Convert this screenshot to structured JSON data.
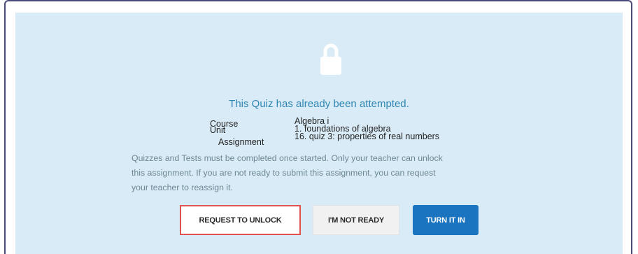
{
  "message": {
    "title": "This Quiz has already been attempted.",
    "labels": {
      "course": "Course",
      "unit": "Unit",
      "assignment": "Assignment"
    },
    "values": {
      "course": "Algebra i",
      "unit": "1. foundations of algebra",
      "assignment": "16. quiz 3: properties of real numbers"
    },
    "description_lines": [
      "Quizzes and Tests must be completed once started. Only your teacher can unlock",
      "this assignment. If you are not ready to submit this assignment, you can request",
      "your teacher to reassign it."
    ]
  },
  "actions": {
    "request_unlock": "REQUEST TO UNLOCK",
    "not_ready": "I'M NOT READY",
    "turn_in": "TURN IT IN"
  },
  "colors": {
    "panel_bg": "#d9ebf6",
    "title": "#2f87b3",
    "primary_button": "#1a74c0",
    "highlight_border": "#e0514f"
  },
  "icons": {
    "lock": "lock-icon"
  }
}
